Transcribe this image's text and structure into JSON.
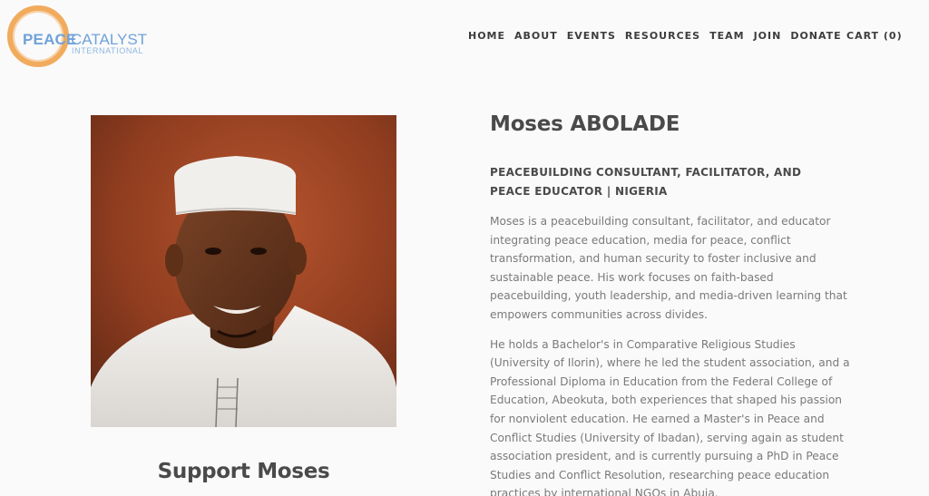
{
  "logo": {
    "peace": "PEACE",
    "catalyst": "CATALYST",
    "international": "INTERNATIONAL",
    "ring_color": "#f0a24b",
    "text_color": "#6fa2d9"
  },
  "nav": {
    "items": [
      {
        "label": "HOME"
      },
      {
        "label": "ABOUT"
      },
      {
        "label": "EVENTS"
      },
      {
        "label": "RESOURCES"
      },
      {
        "label": "TEAM"
      },
      {
        "label": "JOIN"
      },
      {
        "label": "DONATE"
      }
    ],
    "cart": "CART (0)"
  },
  "profile": {
    "name": "Moses ABOLADE",
    "role": "PEACEBUILDING CONSULTANT, FACILITATOR, AND PEACE EDUCATOR | NIGERIA",
    "paragraphs": [
      "Moses is a peacebuilding consultant, facilitator, and educator integrating peace education, media for peace, conflict transformation, and human security to foster inclusive and sustainable peace. His work focuses on faith-based peacebuilding, youth leadership, and media-driven learning that empowers communities across divides.",
      "He holds a Bachelor's in Comparative Religious Studies (University of Ilorin), where he led the student association, and a Professional Diploma in Education from the Federal College of Education, Abeokuta, both experiences that shaped his passion for nonviolent education. He earned a Master's in Peace and Conflict Studies (University of Ibadan), serving again as student association president, and is currently pursuing a PhD in Peace Studies and Conflict Resolution, researching peace education practices by international NGOs in Abuja."
    ],
    "support_heading": "Support Moses"
  }
}
